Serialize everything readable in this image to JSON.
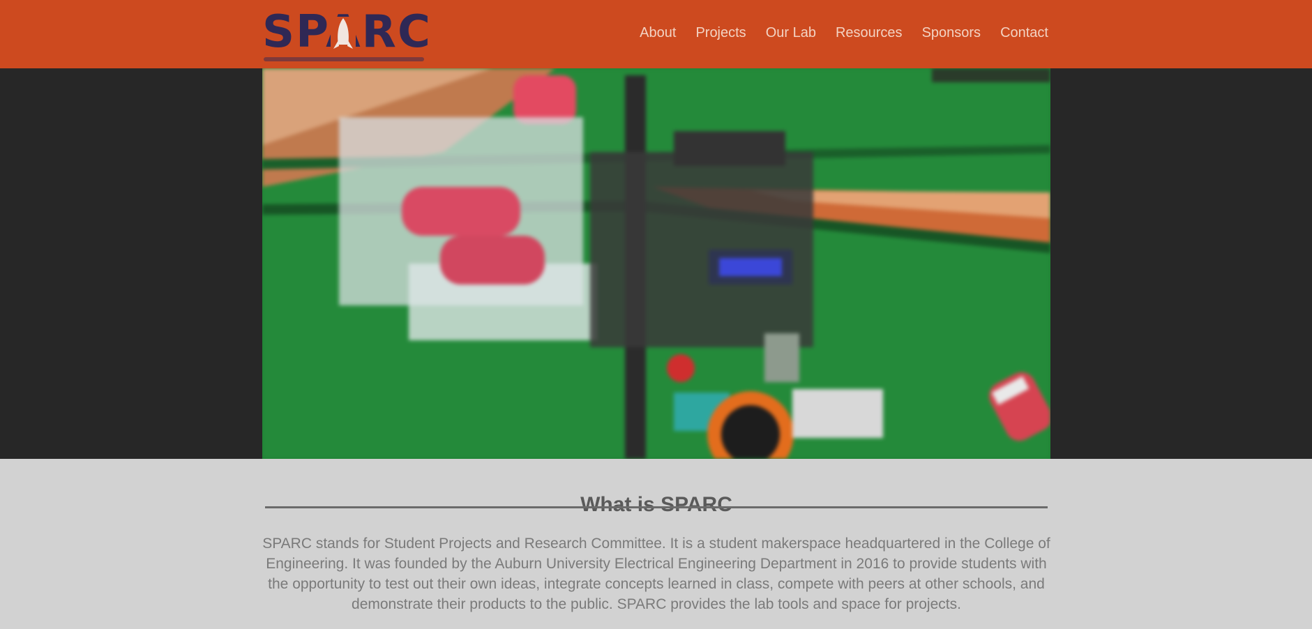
{
  "header": {
    "logo_text": "SPARC",
    "nav": [
      {
        "label": "About"
      },
      {
        "label": "Projects"
      },
      {
        "label": "Our Lab"
      },
      {
        "label": "Resources"
      },
      {
        "label": "Sponsors"
      },
      {
        "label": "Contact"
      }
    ]
  },
  "hero": {
    "screen_text": "SPARC"
  },
  "about": {
    "title": "What is SPARC",
    "body": "SPARC stands for Student Projects and Research Committee. It is a student makerspace headquartered in the College of Engineering. It was founded by the Auburn University Electrical Engineering Department in 2016 to provide students with the opportunity to test out their own ideas, integrate concepts learned in class, compete with peers at other schools, and demonstrate their products to the public. SPARC provides the lab tools and space for projects."
  },
  "colors": {
    "header_bg": "#cd4a1f",
    "logo": "#2f2855",
    "hero_band": "#272727",
    "page_bg": "#d2d2d2"
  }
}
